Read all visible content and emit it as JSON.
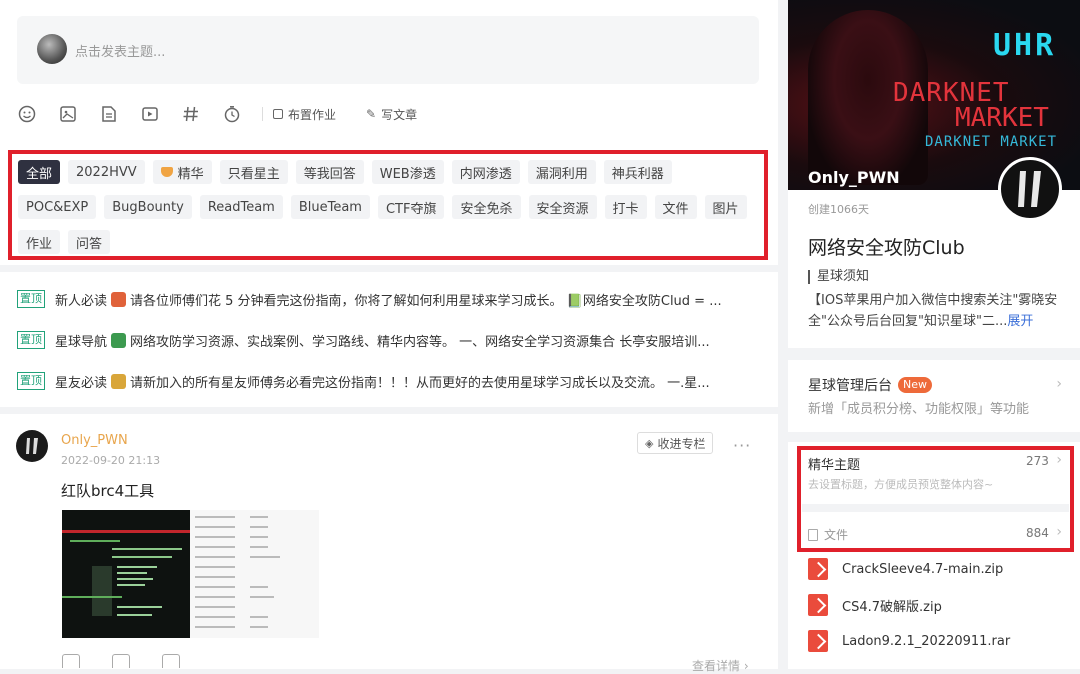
{
  "composer": {
    "placeholder": "点击发表主题...",
    "tools": [
      {
        "icon": "emoji-icon"
      },
      {
        "icon": "image-icon"
      },
      {
        "icon": "file-icon"
      },
      {
        "icon": "video-icon"
      },
      {
        "icon": "hashtag-icon"
      },
      {
        "icon": "clock-icon"
      }
    ],
    "assign_homework": "布置作业",
    "write_article": "写文章"
  },
  "tags": [
    "全部",
    "2022HVV",
    "精华",
    "只看星主",
    "等我回答",
    "WEB渗透",
    "内网渗透",
    "漏洞利用",
    "神兵利器",
    "POC&EXP",
    "BugBounty",
    "ReadTeam",
    "BlueTeam",
    "CTF夺旗",
    "安全免杀",
    "安全资源",
    "打卡",
    "文件",
    "图片",
    "作业",
    "问答"
  ],
  "pinned_badge": "置顶",
  "pinned": [
    {
      "pre": "新人必读",
      "text": "请各位师傅们花 5 分钟看完这份指南，你将了解如何利用星球来学习成长。 📗网络安全攻防Clud = ..."
    },
    {
      "pre": "星球导航",
      "text": "网络攻防学习资源、实战案例、学习路线、精华内容等。 一、网络安全学习资源集合 长亭安服培训..."
    },
    {
      "pre": "星友必读",
      "text": "请新加入的所有星友师傅务必看完这份指南！！！从而更好的去使用星球学习成长以及交流。 一.星..."
    }
  ],
  "post": {
    "author": "Only_PWN",
    "time": "2022-09-20 21:13",
    "collect": "收进专栏",
    "more": "···",
    "title": "红队brc4工具",
    "see_more": "查看详情 ›"
  },
  "sidebar": {
    "banner_name": "Only_PWN",
    "banner_text": {
      "a": "UHR",
      "b": "DARKNET",
      "c": "MARKET",
      "d": "DARKNET MARKET"
    },
    "created": "创建1066天",
    "club_name": "网络安全攻防Club",
    "notice_title": "星球须知",
    "notice_body": "【IOS苹果用户加入微信中搜索关注\"雾晓安全\"公众号后台回复\"知识星球\"二...",
    "expand": "展开",
    "admin_title": "星球管理后台",
    "admin_new": "New",
    "admin_sub": "新增「成员积分榜、功能权限」等功能",
    "highlight_title": "精华主题",
    "highlight_count": "273",
    "highlight_sub": "去设置标题，方便成员预览整体内容~",
    "files_title": "文件",
    "files_count": "884",
    "files": [
      "CrackSleeve4.7-main.zip",
      "CS4.7破解版.zip",
      "Ladon9.2.1_20220911.rar"
    ]
  }
}
